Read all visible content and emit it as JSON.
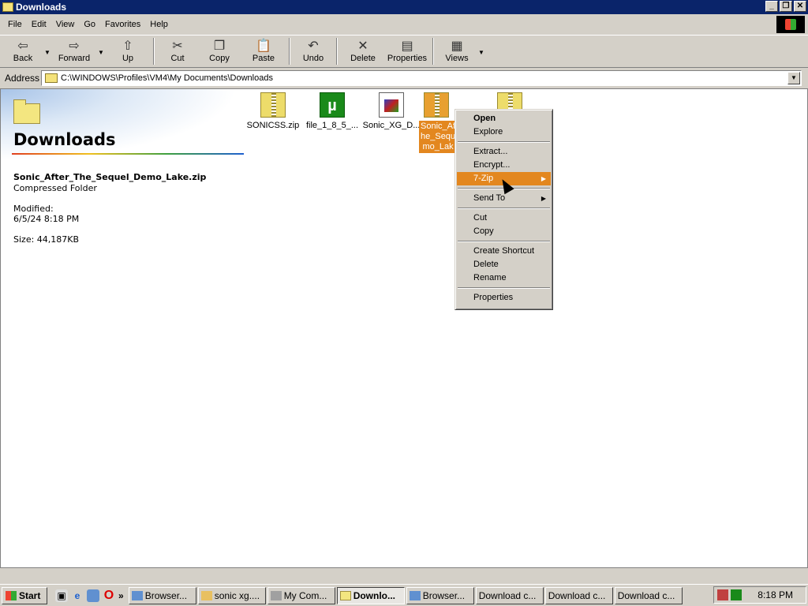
{
  "window": {
    "title": "Downloads"
  },
  "menu": [
    "File",
    "Edit",
    "View",
    "Go",
    "Favorites",
    "Help"
  ],
  "toolbar": {
    "back": "Back",
    "forward": "Forward",
    "up": "Up",
    "cut": "Cut",
    "copy": "Copy",
    "paste": "Paste",
    "undo": "Undo",
    "delete": "Delete",
    "properties": "Properties",
    "views": "Views"
  },
  "address": {
    "label": "Address",
    "value": "C:\\WINDOWS\\Profiles\\VM4\\My Documents\\Downloads"
  },
  "sidepanel": {
    "title": "Downloads",
    "selected_name": "Sonic_After_The_Sequel_Demo_Lake.zip",
    "selected_type": "Compressed Folder",
    "modified_label": "Modified:",
    "modified_value": "6/5/24 8:18 PM",
    "size": "Size: 44,187KB"
  },
  "files": [
    {
      "name": "SONICSS.zip",
      "icon": "zip-icon"
    },
    {
      "name": "file_1_8_5_...",
      "icon": "utorrent-icon"
    },
    {
      "name": "Sonic_XG_D...",
      "icon": "document-icon"
    },
    {
      "name_lines": [
        "Sonic_Af",
        "he_Sequ",
        "mo_Lak"
      ],
      "icon": "zip-icon",
      "selected": true
    },
    {
      "name": "",
      "icon": "zip-icon"
    }
  ],
  "context_menu": {
    "open": "Open",
    "explore": "Explore",
    "extract": "Extract...",
    "encrypt": "Encrypt...",
    "sevenzip": "7-Zip",
    "sendto": "Send To",
    "cut": "Cut",
    "copy": "Copy",
    "create_shortcut": "Create Shortcut",
    "delete": "Delete",
    "rename": "Rename",
    "properties": "Properties"
  },
  "taskbar": {
    "start": "Start",
    "buttons": [
      "Browser...",
      "sonic xg....",
      "My Com...",
      "Downlo...",
      "Browser...",
      "Download c...",
      "Download c...",
      "Download c..."
    ],
    "clock": "8:18 PM"
  },
  "colors": {
    "titlebar": "#0a246a",
    "highlight": "#e3871f",
    "chrome": "#d4d0c8"
  }
}
